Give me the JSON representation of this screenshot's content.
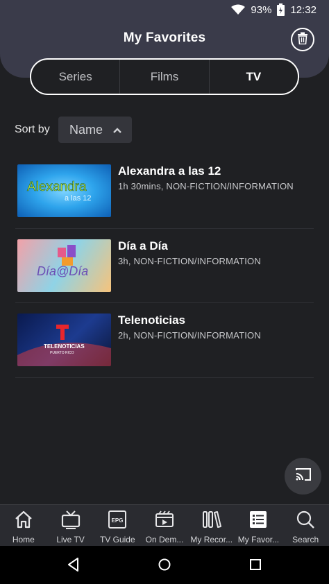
{
  "status_bar": {
    "battery": "93%",
    "time": "12:32"
  },
  "header": {
    "title": "My Favorites"
  },
  "tabs": [
    {
      "label": "Series",
      "active": false
    },
    {
      "label": "Films",
      "active": false
    },
    {
      "label": "TV",
      "active": true
    }
  ],
  "sort": {
    "label": "Sort by",
    "value": "Name"
  },
  "items": [
    {
      "title": "Alexandra a las 12",
      "meta": "1h 30mins, NON-FICTION/INFORMATION",
      "thumb_text": "Alexandra",
      "thumb_subtext": "a las 12"
    },
    {
      "title": "Día a Día",
      "meta": "3h, NON-FICTION/INFORMATION",
      "thumb_text": "Día@Día",
      "thumb_subtext": ""
    },
    {
      "title": "Telenoticias",
      "meta": "2h, NON-FICTION/INFORMATION",
      "thumb_text": "TELENOTICIAS",
      "thumb_subtext": "PUERTO RICO"
    }
  ],
  "bottom_nav": [
    {
      "label": "Home",
      "icon": "home-icon"
    },
    {
      "label": "Live TV",
      "icon": "tv-icon"
    },
    {
      "label": "TV Guide",
      "icon": "epg-icon",
      "icon_text": "EPG"
    },
    {
      "label": "On Dem...",
      "icon": "on-demand-icon"
    },
    {
      "label": "My Recor...",
      "icon": "recordings-icon"
    },
    {
      "label": "My Favor...",
      "icon": "favorites-list-icon"
    },
    {
      "label": "Search",
      "icon": "search-icon"
    }
  ],
  "colors": {
    "background": "#1f2023",
    "header": "#3a3b4a",
    "tabbar": "#2a2b30"
  }
}
